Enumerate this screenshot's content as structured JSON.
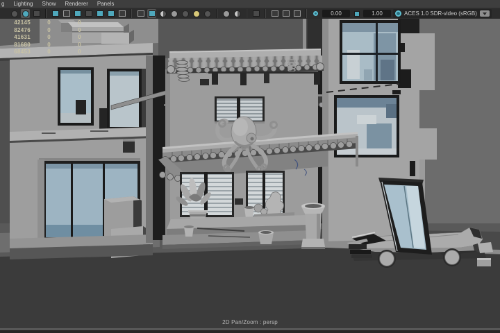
{
  "menu_bar": {
    "items": [
      {
        "label": "g"
      },
      {
        "label": "Lighting"
      },
      {
        "label": "Show"
      },
      {
        "label": "Renderer"
      },
      {
        "label": "Panels"
      }
    ]
  },
  "toolbar": {
    "pan_value": "0.00",
    "zoom_value": "1.00",
    "color_space": "ACES 1.0 SDR-video (sRGB)",
    "icons": [
      "show-manipulators",
      "select-highlight",
      "sculpt-tool",
      "grid",
      "film-gate",
      "resolution-gate",
      "gate-mask",
      "field-chart",
      "safe-action",
      "safe-title",
      "wireframe",
      "smooth-shade-all",
      "textured",
      "use-all-lights",
      "shadows",
      "screen-space-ambient-occlusion",
      "motion-blur",
      "multisampling",
      "depth-of-field",
      "isolate-select",
      "image-plane",
      "duplicate-view",
      "paste-view",
      "snapshot",
      "pan-2d",
      "zoom-2d",
      "color-management"
    ]
  },
  "hud": {
    "rows": [
      [
        "42145",
        "0",
        "0"
      ],
      [
        "82476",
        "0",
        "0"
      ],
      [
        "41631",
        "0",
        "0"
      ],
      [
        "81680",
        "0",
        "0"
      ],
      [
        "68453",
        "0",
        "0"
      ]
    ]
  },
  "viewport": {
    "camera_label": "2D Pan/Zoom : persp",
    "scene_objects": [
      "left-building",
      "center-building",
      "right-building",
      "octopus-sign",
      "tiled-awning",
      "storefront",
      "plants",
      "column-planter",
      "street",
      "car",
      "glass-panel"
    ]
  },
  "colors": {
    "accent_teal": "#4fa8bc",
    "menu_bg": "#3e3e3e",
    "toolbar_bg": "#2c2c2c",
    "field_bg": "#1a1a1a",
    "viewport_bg": "#6c6c6c",
    "hud_text": "#c9c3a4",
    "glass": "#a9bcc6",
    "ground_dark": "#3b3b3b"
  }
}
